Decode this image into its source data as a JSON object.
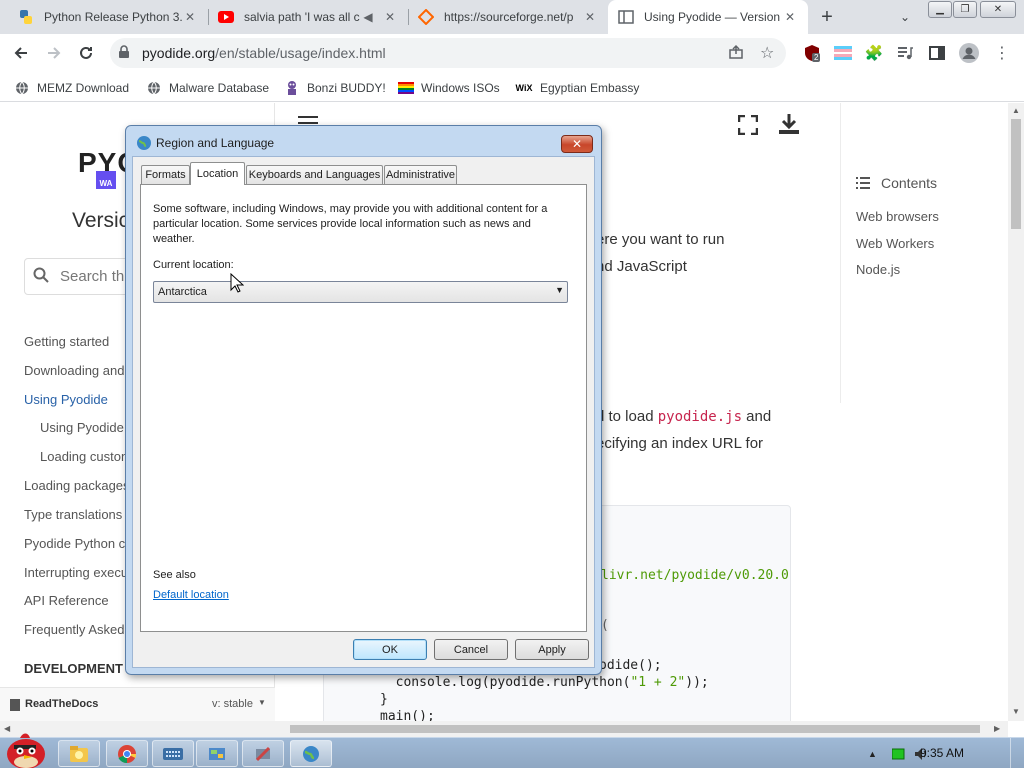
{
  "browser": {
    "tabs": [
      {
        "title": "Python Release Python 3.",
        "icon": "python-icon"
      },
      {
        "title": "salvia path 'I was all c",
        "icon": "youtube-icon"
      },
      {
        "title": "https://sourceforge.net/p",
        "icon": "sourceforge-icon"
      },
      {
        "title": "Using Pyodide — Version",
        "icon": "docs-icon"
      }
    ],
    "url_domain": "pyodide.org",
    "url_path": "/en/stable/usage/index.html",
    "extension_badge": "2",
    "bookmarks": [
      {
        "label": "MEMZ Download"
      },
      {
        "label": "Malware Database"
      },
      {
        "label": "Bonzi BUDDY!"
      },
      {
        "label": "Windows ISOs"
      },
      {
        "label": "Egyptian Embassy"
      }
    ]
  },
  "page": {
    "logo_text": "PYO",
    "logo_badge": "WA",
    "version_heading": "Versic",
    "search_placeholder": "Search th",
    "nav": [
      {
        "label": "Getting started"
      },
      {
        "label": "Downloading and"
      },
      {
        "label": "Using Pyodide"
      },
      {
        "label": "Using Pyodide"
      },
      {
        "label": "Loading custon"
      },
      {
        "label": "Loading packages"
      },
      {
        "label": "Type translations"
      },
      {
        "label": "Pyodide Python co"
      },
      {
        "label": "Interrupting execu"
      },
      {
        "label": "API Reference"
      },
      {
        "label": "Frequently Asked"
      }
    ],
    "development_heading": "DEVELOPMENT",
    "rtd_label": "ReadTheDocs",
    "rtd_version": "v: stable",
    "body_line1": "ere you want to run",
    "body_line2": "nd JavaScript",
    "body_line3_pre": "d to load ",
    "body_line3_code": "pyodide.js",
    "body_line3_post": " and",
    "body_line4": "ecifying an index URL for",
    "code_lines": {
      "url": "livr.net/pyodide/v0.20.0",
      "frag": "(",
      "c1": "odide();",
      "c2": "  console.log(pyodide.runPython(",
      "c2_str": "\"1 + 2\"",
      "c2_end": "));",
      "c3": "}",
      "c4": "main();"
    },
    "toc_title": "Contents",
    "toc": [
      "Web browsers",
      "Web Workers",
      "Node.js"
    ]
  },
  "dialog": {
    "title": "Region and Language",
    "tabs": [
      "Formats",
      "Location",
      "Keyboards and Languages",
      "Administrative"
    ],
    "description": "Some software, including Windows, may provide you with additional content for a particular location. Some services provide local information such as news and weather.",
    "current_location_label": "Current location:",
    "current_location_value": "Antarctica",
    "see_also": "See also",
    "default_location_link": "Default location",
    "buttons": {
      "ok": "OK",
      "cancel": "Cancel",
      "apply": "Apply"
    }
  },
  "taskbar": {
    "clock": "9:35 AM"
  }
}
